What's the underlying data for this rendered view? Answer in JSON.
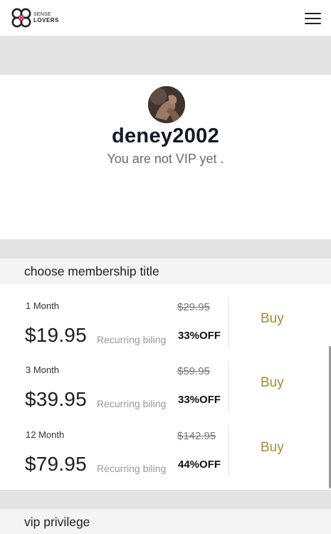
{
  "header": {
    "logo": {
      "line1": "SENSE",
      "line2": "LOVERS",
      "icon": "sense-lovers-logo-icon"
    },
    "menu_icon": "hamburger-menu-icon"
  },
  "profile": {
    "avatar_icon": "user-avatar",
    "username": "deney2002",
    "status": "You are not VIP yet ."
  },
  "membership": {
    "title": "choose membership title",
    "plans": [
      {
        "name": "1 Month",
        "price": "$19.95",
        "recurring": "Recurring biling",
        "original": "$29.95",
        "discount": "33%OFF",
        "buy_label": "Buy"
      },
      {
        "name": "3 Month",
        "price": "$39.95",
        "recurring": "Recurring biling",
        "original": "$59.95",
        "discount": "33%OFF",
        "buy_label": "Buy"
      },
      {
        "name": "12 Month",
        "price": "$79.95",
        "recurring": "Recurring biling",
        "original": "$142.95",
        "discount": "44%OFF",
        "buy_label": "Buy"
      }
    ]
  },
  "vip_section": {
    "title": "vip privilege"
  },
  "colors": {
    "accent_buy": "#a38d38",
    "logo_accent": "#e6315b",
    "band_gray": "#e3e3e3"
  }
}
